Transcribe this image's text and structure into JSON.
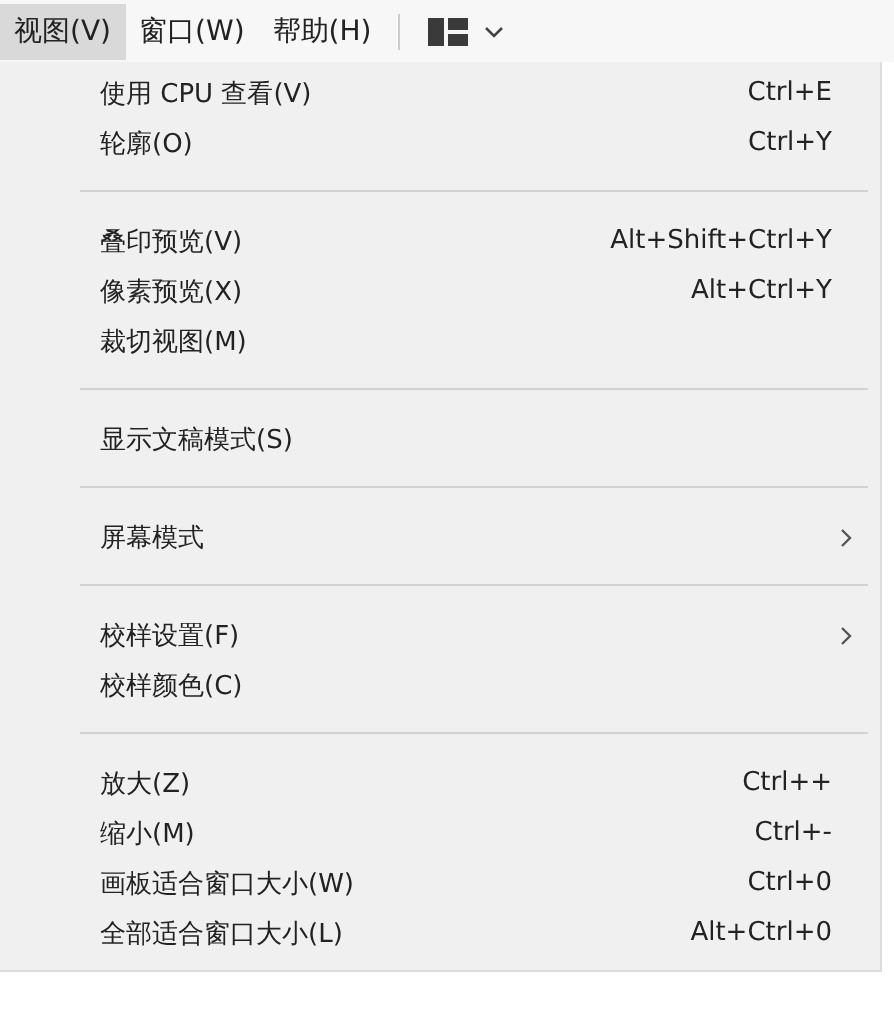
{
  "menubar": {
    "items": [
      {
        "label": "视图(V)",
        "selected": true
      },
      {
        "label": "窗口(W)",
        "selected": false
      },
      {
        "label": "帮助(H)",
        "selected": false
      }
    ]
  },
  "menu": {
    "groups": [
      {
        "items": [
          {
            "label": "使用 CPU 查看(V)",
            "shortcut": "Ctrl+E",
            "submenu": false
          },
          {
            "label": "轮廓(O)",
            "shortcut": "Ctrl+Y",
            "submenu": false
          }
        ]
      },
      {
        "items": [
          {
            "label": "叠印预览(V)",
            "shortcut": "Alt+Shift+Ctrl+Y",
            "submenu": false
          },
          {
            "label": "像素预览(X)",
            "shortcut": "Alt+Ctrl+Y",
            "submenu": false
          },
          {
            "label": "裁切视图(M)",
            "submenu": false
          }
        ]
      },
      {
        "items": [
          {
            "label": "显示文稿模式(S)",
            "submenu": false
          }
        ]
      },
      {
        "items": [
          {
            "label": "屏幕模式",
            "submenu": true
          }
        ]
      },
      {
        "items": [
          {
            "label": "校样设置(F)",
            "submenu": true
          },
          {
            "label": "校样颜色(C)",
            "submenu": false
          }
        ]
      },
      {
        "items": [
          {
            "label": "放大(Z)",
            "shortcut": "Ctrl++",
            "submenu": false
          },
          {
            "label": "缩小(M)",
            "shortcut": "Ctrl+-",
            "submenu": false
          },
          {
            "label": "画板适合窗口大小(W)",
            "shortcut": "Ctrl+0",
            "submenu": false
          },
          {
            "label": "全部适合窗口大小(L)",
            "shortcut": "Alt+Ctrl+0",
            "submenu": false
          }
        ]
      }
    ]
  }
}
